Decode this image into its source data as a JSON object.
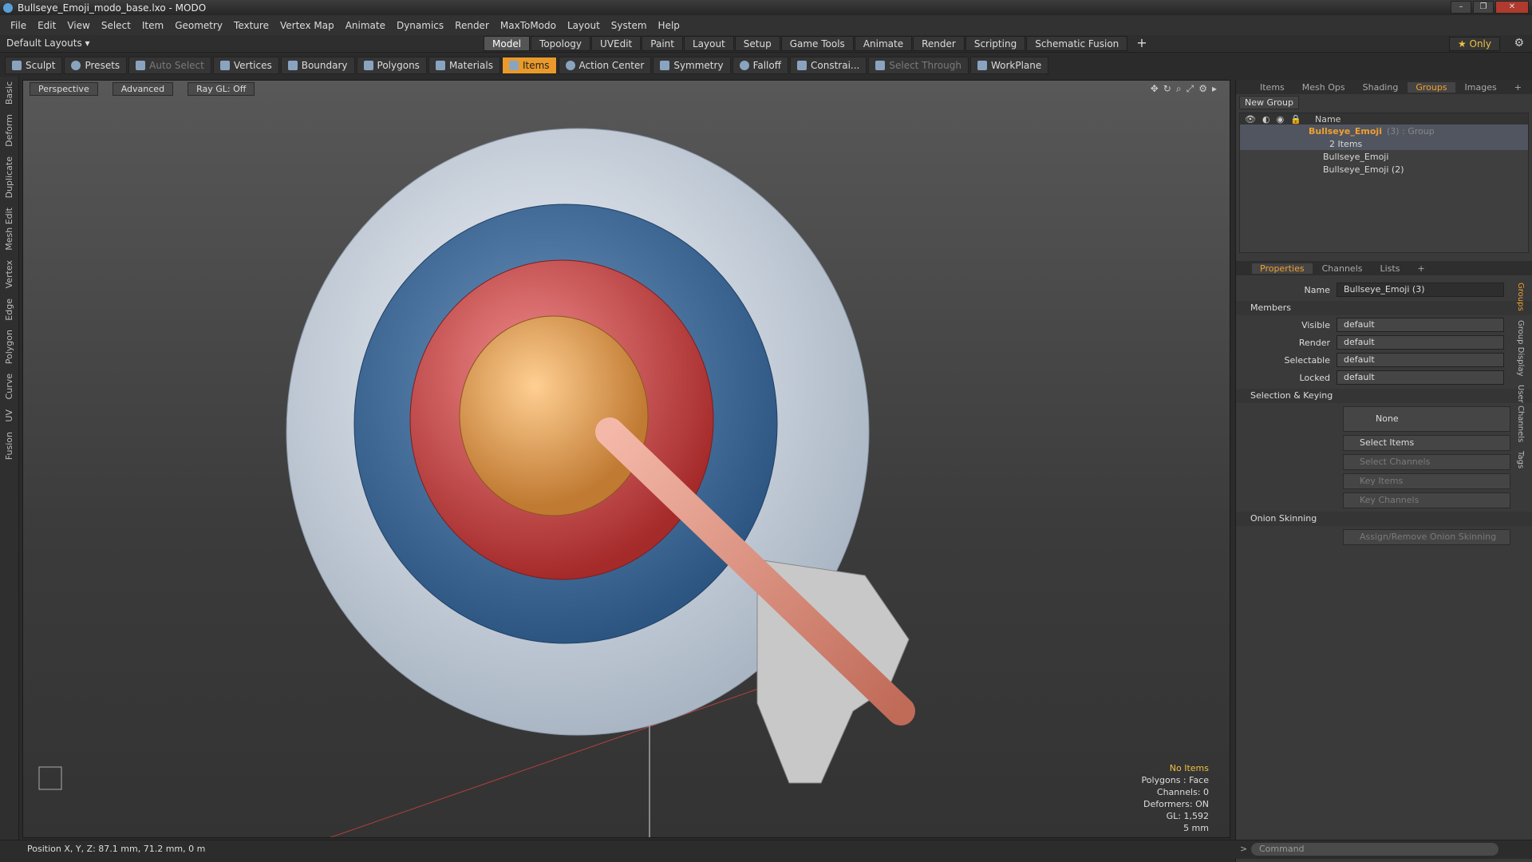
{
  "window": {
    "title": "Bullseye_Emoji_modo_base.lxo - MODO",
    "minimize": "–",
    "restore": "❐",
    "close": "✕"
  },
  "menu": [
    "File",
    "Edit",
    "View",
    "Select",
    "Item",
    "Geometry",
    "Texture",
    "Vertex Map",
    "Animate",
    "Dynamics",
    "Render",
    "MaxToModo",
    "Layout",
    "System",
    "Help"
  ],
  "layouts": {
    "dropdown": "Default Layouts ▾",
    "tabs": [
      "Model",
      "Topology",
      "UVEdit",
      "Paint",
      "Layout",
      "Setup",
      "Game Tools",
      "Animate",
      "Render",
      "Scripting",
      "Schematic Fusion"
    ],
    "active_tab": "Model",
    "add": "+",
    "only": "★ Only"
  },
  "toolbar": {
    "sculpt": "Sculpt",
    "presets": "Presets",
    "auto_select": "Auto Select",
    "vertices": "Vertices",
    "boundary": "Boundary",
    "polygons": "Polygons",
    "materials": "Materials",
    "items": "Items",
    "action_center": "Action Center",
    "symmetry": "Symmetry",
    "falloff": "Falloff",
    "constraints": "Constrai...",
    "select_through": "Select Through",
    "workplane": "WorkPlane"
  },
  "left_tabs": [
    "Basic",
    "Deform",
    "Duplicate",
    "Mesh Edit",
    "Vertex",
    "Edge",
    "Polygon",
    "Curve",
    "UV",
    "Fusion"
  ],
  "viewport": {
    "view": "Perspective",
    "shading": "Advanced",
    "raygl": "Ray GL: Off",
    "info": {
      "items": "No Items",
      "polygons": "Polygons : Face",
      "channels": "Channels: 0",
      "deformers": "Deformers: ON",
      "gl": "GL: 1,592",
      "scale": "5 mm"
    }
  },
  "status": {
    "position": "Position X, Y, Z:  87.1 mm, 71.2 mm, 0 m"
  },
  "groups_panel": {
    "tabs": [
      "Items",
      "Mesh Ops",
      "Shading",
      "Groups",
      "Images",
      "+"
    ],
    "active": "Groups",
    "new_group": "New Group",
    "header_name": "Name",
    "rows": [
      {
        "name": "Bullseye_Emoji",
        "suffix": "(3) : Group",
        "sub": "2 Items"
      },
      {
        "name": "Bullseye_Emoji"
      },
      {
        "name": "Bullseye_Emoji (2)"
      }
    ]
  },
  "properties": {
    "tabs": [
      "Properties",
      "Channels",
      "Lists",
      "+"
    ],
    "active": "Properties",
    "name_label": "Name",
    "name_value": "Bullseye_Emoji (3)",
    "members_section": "Members",
    "fields": [
      {
        "label": "Visible",
        "value": "default"
      },
      {
        "label": "Render",
        "value": "default"
      },
      {
        "label": "Selectable",
        "value": "default"
      },
      {
        "label": "Locked",
        "value": "default"
      }
    ],
    "selection_section": "Selection & Keying",
    "none": "None",
    "select_items": "Select Items",
    "select_channels": "Select Channels",
    "key_items": "Key Items",
    "key_channels": "Key Channels",
    "onion_section": "Onion Skinning",
    "onion_button": "Assign/Remove Onion Skinning",
    "side_tabs": [
      "Groups",
      "Group Display",
      "User Channels",
      "Tags"
    ]
  },
  "command": {
    "placeholder": "Command",
    "prompt": ">"
  },
  "colors": {
    "accent": "#f0a030",
    "items_active": "#e99a2a"
  }
}
